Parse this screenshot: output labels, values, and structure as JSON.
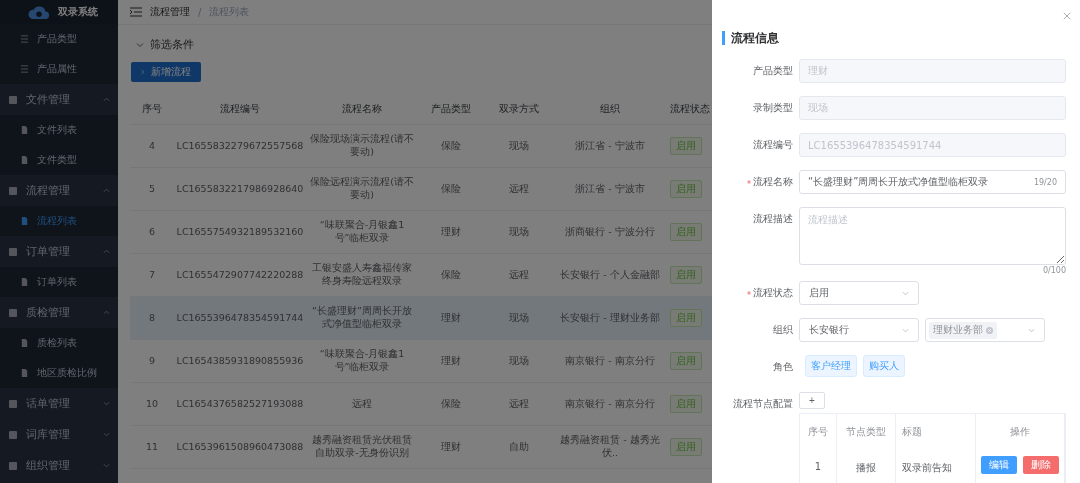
{
  "sidebar": {
    "logo_text": "双录系统",
    "items": [
      {
        "kind": "link",
        "label": "产品类型",
        "selected": false
      },
      {
        "kind": "link",
        "label": "产品属性",
        "selected": false
      },
      {
        "kind": "group",
        "label": "文件管理",
        "expanded": true,
        "children": [
          {
            "label": "文件列表",
            "selected": false
          },
          {
            "label": "文件类型",
            "selected": false
          }
        ]
      },
      {
        "kind": "group",
        "label": "流程管理",
        "expanded": true,
        "children": [
          {
            "label": "流程列表",
            "selected": true
          }
        ]
      },
      {
        "kind": "group",
        "label": "订单管理",
        "expanded": true,
        "children": [
          {
            "label": "订单列表",
            "selected": false
          }
        ]
      },
      {
        "kind": "group",
        "label": "质检管理",
        "expanded": true,
        "children": [
          {
            "label": "质检列表",
            "selected": false
          },
          {
            "label": "地区质检比例",
            "selected": false
          }
        ]
      },
      {
        "kind": "group",
        "label": "话单管理",
        "expanded": false
      },
      {
        "kind": "group",
        "label": "词库管理",
        "expanded": false
      },
      {
        "kind": "group",
        "label": "组织管理",
        "expanded": false
      }
    ]
  },
  "header": {
    "breadcrumb": [
      "流程管理",
      "流程列表"
    ],
    "separator": "/"
  },
  "filter": {
    "label": "筛选条件",
    "expanded": true
  },
  "add_button": "新增流程",
  "table": {
    "columns": [
      "序号",
      "流程编号",
      "流程名称",
      "产品类型",
      "双录方式",
      "组织",
      "流程状态"
    ],
    "rows": [
      {
        "cells": [
          "4",
          "LC1655832279672557568",
          "保险现场演示流程(请不要动)",
          "保险",
          "现场",
          "浙江省 - 宁波市"
        ],
        "status": "启用",
        "selected": false
      },
      {
        "cells": [
          "5",
          "LC1655832217986928640",
          "保险远程演示流程(请不要动)",
          "保险",
          "远程",
          "浙江省 - 宁波市"
        ],
        "status": "启用",
        "selected": false
      },
      {
        "cells": [
          "6",
          "LC1655754932189532160",
          "“味联聚合-月银鑫1号”临柜双录",
          "理财",
          "现场",
          "浙商银行 - 宁波分行"
        ],
        "status": "启用",
        "selected": false
      },
      {
        "cells": [
          "7",
          "LC1655472907742220288",
          "工银安盛人寿鑫福传家终身寿险远程双录",
          "保险",
          "远程",
          "长安银行 - 个人金融部"
        ],
        "status": "启用",
        "selected": false
      },
      {
        "cells": [
          "8",
          "LC1655396478354591744",
          "“长盛理财”周周长开放式净值型临柜双录",
          "理财",
          "现场",
          "长安银行 - 理财业务部"
        ],
        "status": "启用",
        "selected": true
      },
      {
        "cells": [
          "9",
          "LC1654385931890855936",
          "“味联聚合-月银鑫1号”临柜双录",
          "理财",
          "现场",
          "南京银行 - 南京分行"
        ],
        "status": "启用",
        "selected": false
      },
      {
        "cells": [
          "10",
          "LC1654376582527193088",
          "远程",
          "保险",
          "远程",
          "南京银行 - 南京分行"
        ],
        "status": "启用",
        "selected": false
      },
      {
        "cells": [
          "11",
          "LC1653961508960473088",
          "越秀融资租赁光伏租赁自助双录-无身份识别",
          "理财",
          "自助",
          "越秀融资租赁 - 越秀光伏.."
        ],
        "status": "启用",
        "selected": false
      }
    ]
  },
  "drawer": {
    "title": "流程信息",
    "fields": [
      {
        "kind": "input",
        "label": "产品类型",
        "value": "理财",
        "disabled": true,
        "required": false
      },
      {
        "kind": "input",
        "label": "录制类型",
        "value": "现场",
        "disabled": true,
        "required": false
      },
      {
        "kind": "input",
        "label": "流程编号",
        "value": "LC1655396478354591744",
        "disabled": true,
        "required": false
      },
      {
        "kind": "input",
        "label": "流程名称",
        "value": "“长盛理财”周周长开放式净值型临柜双录",
        "counter": "19/20",
        "disabled": false,
        "required": true
      },
      {
        "kind": "textarea",
        "label": "流程描述",
        "placeholder": "流程描述",
        "counter": "0/100",
        "required": false
      },
      {
        "kind": "select",
        "label": "流程状态",
        "value": "启用",
        "required": true
      },
      {
        "kind": "org",
        "label": "组织",
        "value": "长安银行",
        "tags": [
          "理财业务部"
        ],
        "required": false
      },
      {
        "kind": "roles",
        "label": "角色",
        "tags": [
          "客户经理",
          "购买人"
        ],
        "required": false
      },
      {
        "kind": "nodes",
        "label": "流程节点配置",
        "add": "+",
        "columns": [
          "序号",
          "节点类型",
          "标题",
          "操作"
        ],
        "rows": [
          {
            "cells": [
              "1",
              "播报",
              "双录前告知"
            ],
            "actions": [
              "编辑",
              "删除"
            ]
          }
        ],
        "required": false
      }
    ]
  }
}
